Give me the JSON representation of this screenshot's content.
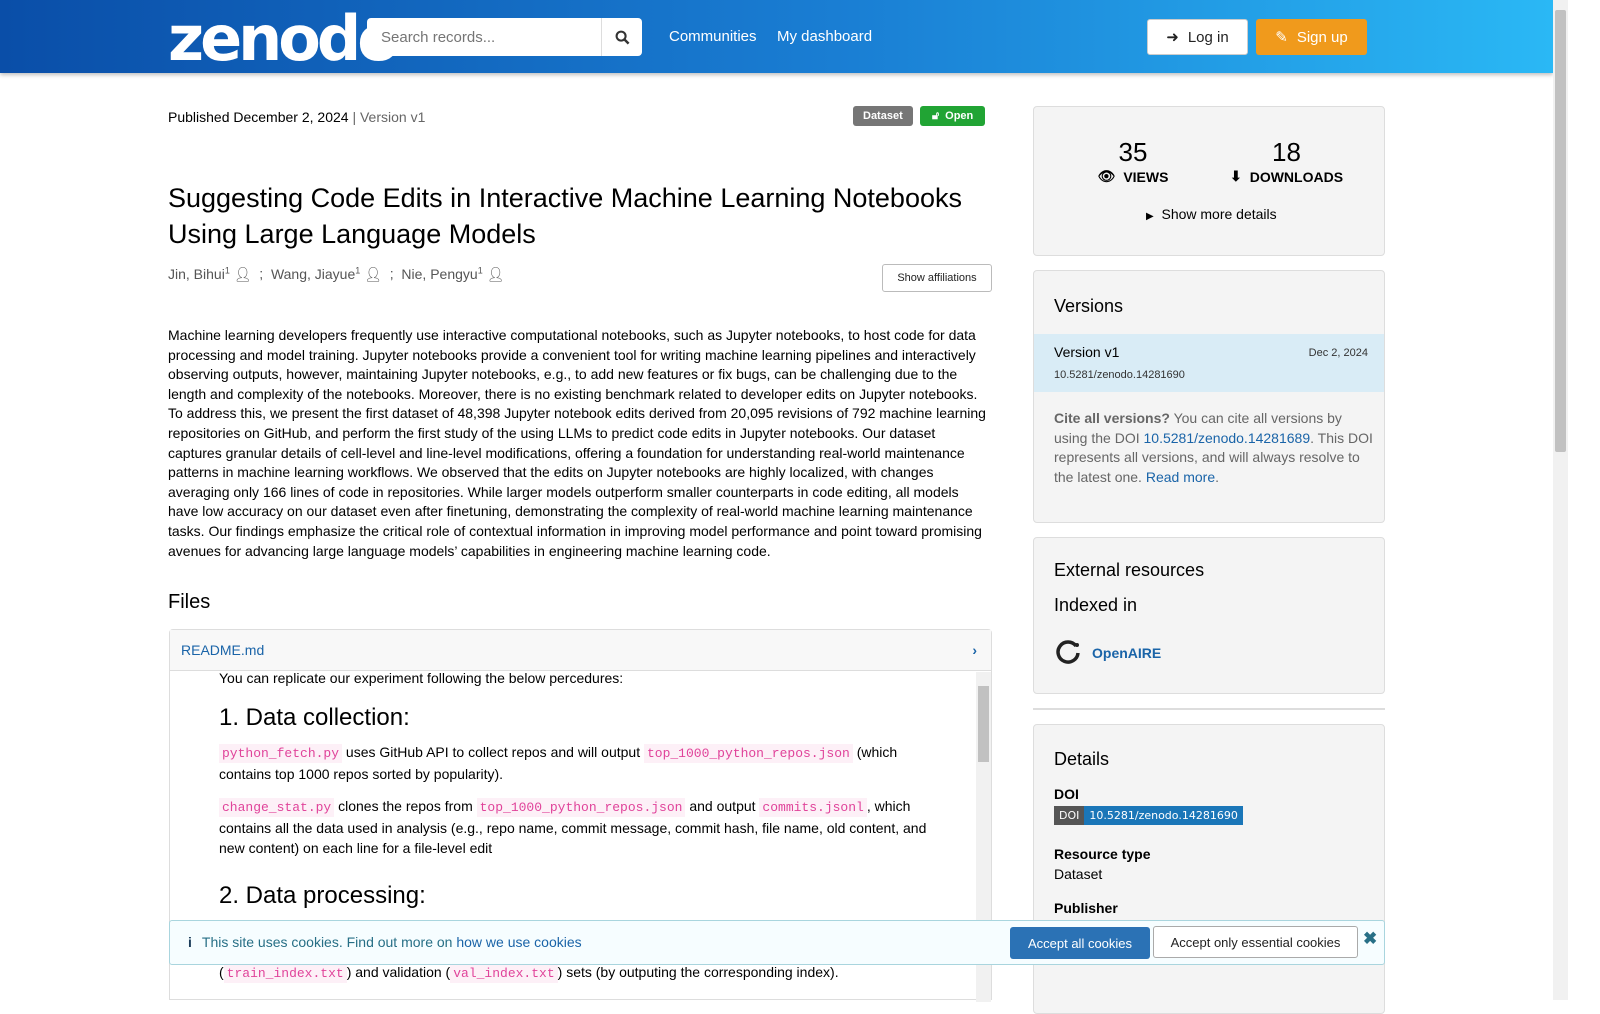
{
  "header": {
    "logo": "zenodo",
    "search_placeholder": "Search records...",
    "nav": [
      "Communities",
      "My dashboard"
    ],
    "login": "Log in",
    "signup": "Sign up"
  },
  "record": {
    "published": "Published December 2, 2024",
    "version": "| Version v1",
    "badge_type": "Dataset",
    "badge_access": "Open",
    "title": "Suggesting Code Edits in Interactive Machine Learning Notebooks Using Large Language Models",
    "authors": [
      {
        "name": "Jin, Bihui",
        "sup": "1"
      },
      {
        "name": "Wang, Jiayue",
        "sup": "1"
      },
      {
        "name": "Nie, Pengyu",
        "sup": "1"
      }
    ],
    "show_affiliations": "Show affiliations",
    "abstract": "Machine learning developers frequently use interactive computational notebooks, such as Jupyter notebooks, to host code for data processing and model training. Jupyter notebooks provide a convenient tool for writing machine learning pipelines and interactively observing outputs, however, maintaining Jupyter notebooks, e.g., to add new features or fix bugs, can be challenging due to the length and complexity of the notebooks. Moreover, there is no existing benchmark related to developer edits on Jupyter notebooks. To address this, we present the first dataset of 48,398 Jupyter notebook edits derived from 20,095 revisions of 792 machine learning repositories on GitHub, and perform the first study of the using LLMs to predict code edits in Jupyter notebooks. Our dataset captures granular details of cell-level and line-level modifications, offering a foundation for understanding real-world maintenance patterns in machine learning workflows. We observed that the edits on Jupyter notebooks are highly localized, with changes averaging only 166 lines of code in repositories. While larger models outperform smaller counterparts in code editing, all models have low accuracy on our dataset even after finetuning, demonstrating the complexity of real-world machine learning maintenance tasks. Our findings emphasize the critical role of contextual information in improving model performance and point toward promising avenues for advancing large language models’ capabilities in engineering machine learning code."
  },
  "files": {
    "heading": "Files",
    "readme_name": "README.md",
    "readme": {
      "intro": "You can replicate our experiment following the below percedures:",
      "h1": "1. Data collection:",
      "p1": [
        "python_fetch.py",
        " uses GitHub API to collect repos and will output ",
        "top_1000_python_repos.json",
        " (which contains top 1000 repos sorted by popularity)."
      ],
      "p2": [
        "change_stat.py",
        " clones the repos from ",
        "top_1000_python_repos.json",
        " and output ",
        "commits.jsonl",
        ", which contains all the data used in analysis (e.g., repo name, commit message, commit hash, file name, old content, and new content) on each line for a file-level edit"
      ],
      "h2": "2. Data processing:",
      "p3": [
        "(",
        "train_index.txt",
        ") and validation (",
        "val_index.txt",
        ") sets (by outputing the corresponding index)."
      ]
    }
  },
  "stats": {
    "views": "35",
    "views_label": "VIEWS",
    "downloads": "18",
    "downloads_label": "DOWNLOADS",
    "more": "Show more details"
  },
  "versions": {
    "heading": "Versions",
    "item": {
      "label": "Version v1",
      "date": "Dec 2, 2024",
      "doi": "10.5281/zenodo.14281690"
    },
    "cite_bold": "Cite all versions?",
    "cite_1": " You can cite all versions by using the DOI ",
    "cite_doi": "10.5281/zenodo.14281689",
    "cite_2": ". This DOI represents all versions, and will always resolve to the latest one. ",
    "read_more": "Read more",
    "cite_end": "."
  },
  "external": {
    "heading": "External resources",
    "indexed": "Indexed in",
    "openaire": "OpenAIRE"
  },
  "details": {
    "heading": "Details",
    "doi_label": "DOI",
    "doi_prefix": "DOI",
    "doi": "10.5281/zenodo.14281690",
    "rtype_label": "Resource type",
    "rtype": "Dataset",
    "publisher_label": "Publisher"
  },
  "cookie": {
    "text": "This site uses cookies. Find out more on ",
    "link": "how we use cookies",
    "accept_all": "Accept all cookies",
    "accept_essential": "Accept only essential cookies"
  }
}
